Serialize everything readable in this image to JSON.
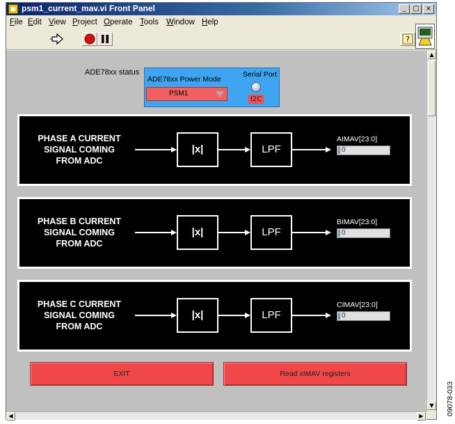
{
  "window": {
    "title": "psm1_current_mav.vi Front Panel",
    "controls": {
      "minimize": "_",
      "maximize": "□",
      "close": "×"
    }
  },
  "menu": {
    "items": [
      {
        "ul": "F",
        "rest": "ile"
      },
      {
        "ul": "E",
        "rest": "dit"
      },
      {
        "ul": "V",
        "rest": "iew"
      },
      {
        "ul": "P",
        "rest": "roject"
      },
      {
        "ul": "O",
        "rest": "perate"
      },
      {
        "ul": "T",
        "rest": "ools"
      },
      {
        "ul": "W",
        "rest": "indow"
      },
      {
        "ul": "H",
        "rest": "elp"
      }
    ]
  },
  "toolbar": {
    "buttons": [
      "run-arrow-icon",
      "abort-icon",
      "pause-icon"
    ],
    "help_icon": "help-icon"
  },
  "status": {
    "label": "ADE78xx status",
    "power_mode_label": "ADE78xx Power Mode",
    "power_mode_value": "PSM1",
    "serial_port_label": "Serial Port",
    "serial_port_value": "I2C"
  },
  "phases": [
    {
      "title_lines": [
        "PHASE A CURRENT",
        "SIGNAL COMING",
        "FROM ADC"
      ],
      "abs_label": "|x|",
      "lpf_label": "LPF",
      "register_label": "AIMAV[23:0]",
      "register_value": "0"
    },
    {
      "title_lines": [
        "PHASE B CURRENT",
        "SIGNAL COMING",
        "FROM ADC"
      ],
      "abs_label": "|x|",
      "lpf_label": "LPF",
      "register_label": "BIMAV[23:0]",
      "register_value": "0"
    },
    {
      "title_lines": [
        "PHASE C CURRENT",
        "SIGNAL COMING",
        "FROM ADC"
      ],
      "abs_label": "|x|",
      "lpf_label": "LPF",
      "register_label": "CIMAV[23:0]",
      "register_value": "0"
    }
  ],
  "buttons": {
    "exit_label": "EXIT",
    "read_label": "Read xIMAV registers"
  },
  "figure_code": "09078-033",
  "colors": {
    "panel_bg": "#c0c0c0",
    "status_box": "#3fa5f0",
    "alert_red": "#f04848",
    "block_bg": "#000000"
  }
}
